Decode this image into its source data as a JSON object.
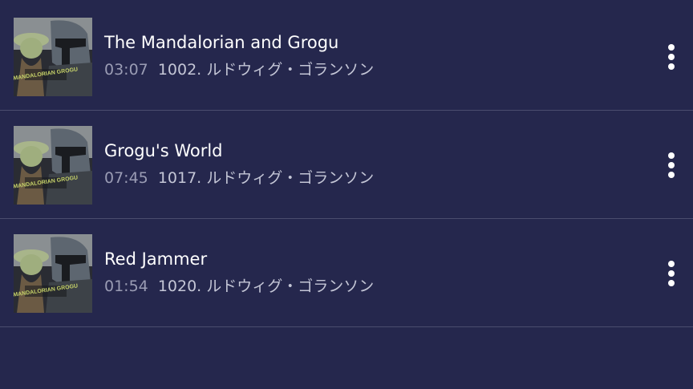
{
  "tracks": [
    {
      "title": "The Mandalorian and Grogu",
      "duration": "03:07",
      "artist": "1002. ルドウィグ・ゴランソン",
      "album_art_text": "MANDALORIAN GROGU"
    },
    {
      "title": "Grogu's World",
      "duration": "07:45",
      "artist": "1017. ルドウィグ・ゴランソン",
      "album_art_text": "MANDALORIAN GROGU"
    },
    {
      "title": "Red Jammer",
      "duration": "01:54",
      "artist": "1020. ルドウィグ・ゴランソン",
      "album_art_text": "MANDALORIAN GROGU"
    }
  ],
  "icons": {
    "more": "more-vertical-icon"
  },
  "colors": {
    "background": "#25274d",
    "title_text": "#ffffff",
    "meta_text": "#9a9cb4",
    "divider": "#4a4d6e"
  }
}
